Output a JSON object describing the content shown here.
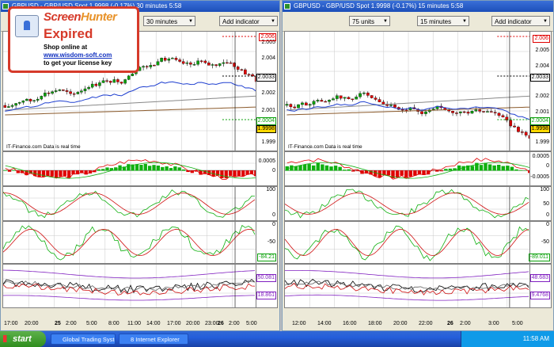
{
  "left_window": {
    "title": "GBPUSD - GBP/USD Spot   1.9998 (-0.17%)   30 minutes  5:58",
    "toolbar": {
      "interval": "30 minutes",
      "add_indicator": "Add indicator"
    },
    "price_axis": [
      "2.006",
      "2.005",
      "2.004",
      "2.003",
      "2.002",
      "2.001",
      "1.999"
    ],
    "price_markers": {
      "high": "2.006",
      "mid": "2.0033",
      "low": "2.0004",
      "current": "1.9998"
    },
    "footer_label": "IT-Finance.com  Data is real time",
    "macd_axis": [
      "0.0005",
      "0",
      "-0.0005"
    ],
    "stoch_axis": [
      "100",
      "50",
      "0"
    ],
    "willr_axis": [
      "0",
      "-50",
      "-100"
    ],
    "willr_value": "-84.21",
    "bands_axis": [
      "50.081",
      "18.861"
    ],
    "time_axis": [
      "17:00",
      "20:00",
      "25",
      "2:00",
      "5:00",
      "8:00",
      "11:00",
      "14:00",
      "17:00",
      "20:00",
      "23:00",
      "26",
      "2:00",
      "5:00"
    ]
  },
  "right_window": {
    "title": "GBPUSD - GBP/USD Spot   1.9998 (-0.17%)   15 minutes  5:58",
    "toolbar": {
      "units": "75 units",
      "interval": "15 minutes",
      "add_indicator": "Add indicator"
    },
    "price_axis": [
      "2.006",
      "2.005",
      "2.004",
      "2.003",
      "2.002",
      "2.001",
      "1.999"
    ],
    "price_markers": {
      "high": "2.006",
      "mid": "2.0033",
      "low": "2.0004",
      "current": "1.9998"
    },
    "footer_label": "IT-Finance.com  Data is real time",
    "macd_axis": [
      "0.0005",
      "0",
      "-0.0005"
    ],
    "stoch_axis": [
      "100",
      "50",
      "0"
    ],
    "willr_axis": [
      "0",
      "-50",
      "-100"
    ],
    "willr_value": "-89.011",
    "bands_axis": [
      "48.683",
      "9.4768"
    ],
    "time_axis": [
      "12:00",
      "14:00",
      "16:00",
      "18:00",
      "20:00",
      "22:00",
      "26",
      "2:00",
      "3:00",
      "5:00"
    ]
  },
  "overlay": {
    "brand_a": "Screen",
    "brand_b": "Hunter",
    "status": "Expired",
    "line1": "Shop online at",
    "line2": "www.wisdom-soft.com",
    "line3": "to get your license key"
  },
  "taskbar": {
    "start": "start",
    "tasks": [
      "Global Trading Syste...",
      "8 Internet Explorer"
    ],
    "clock": "11:58 AM"
  },
  "colors": {
    "bull": "#0aa00a",
    "bear": "#e00000",
    "ma_blue": "#2040d0",
    "ma_brown": "#8b5a2b",
    "stoch_green": "#10b010",
    "stoch_red": "#d01010",
    "band_purple": "#8020c0"
  }
}
